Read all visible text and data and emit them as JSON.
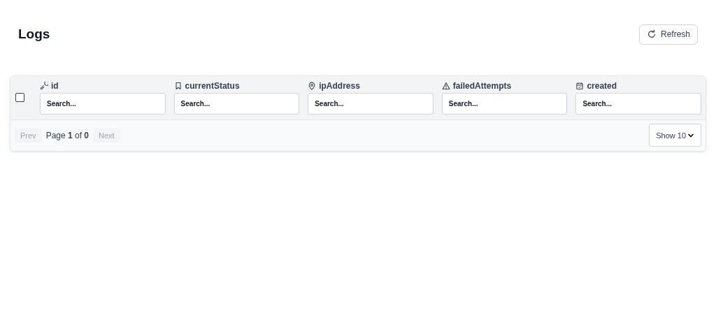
{
  "page": {
    "title": "Logs"
  },
  "refresh_button": {
    "label": "Refresh"
  },
  "table": {
    "select_all": {
      "checked": false
    },
    "columns": [
      {
        "label": "id",
        "kind": "key",
        "placeholder": "Search..."
      },
      {
        "label": "currentStatus",
        "kind": "bookmark",
        "placeholder": "Search..."
      },
      {
        "label": "ipAddress",
        "kind": "location",
        "placeholder": "Search..."
      },
      {
        "label": "failedAttempts",
        "kind": "warning",
        "placeholder": "Search..."
      },
      {
        "label": "created",
        "kind": "calendar",
        "placeholder": "Search..."
      }
    ]
  },
  "pagination": {
    "prev": {
      "label": "Prev",
      "disabled": true
    },
    "page_info": "Page **1** of **0**",
    "next": {
      "label": "Next",
      "disabled": true
    },
    "page_size": "Show 10"
  }
}
